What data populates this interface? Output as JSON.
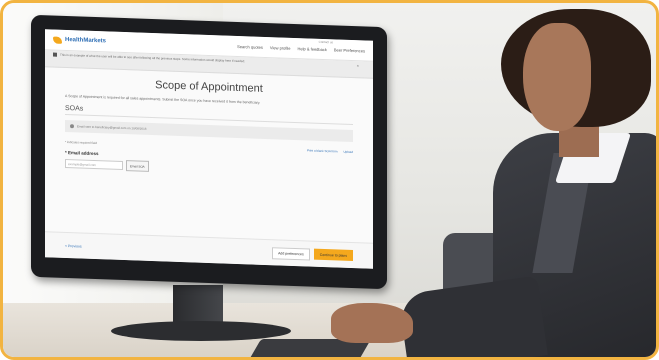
{
  "site": {
    "brand": "HealthMarkets",
    "nav": [
      "Search quotes",
      "View profile",
      "Help & feedback",
      "Beer Preferences"
    ],
    "header_note": "Contact us",
    "notice": "This is an example of what the user will be able to see after following all the previous steps. Some information would display here if needed."
  },
  "page": {
    "title": "Scope of Appointment",
    "intro": "A Scope of Appointment is required for all sales appointments. Submit the SOA once you have received it from the beneficiary.",
    "section_title": "SOAs",
    "info_text": "Email sent to beneficiary@gmail.com on 10/08/2018",
    "required_note": "* indicates required field",
    "actions": [
      "Print a blank SOA form",
      "Upload"
    ],
    "email_label": "* Email address",
    "email_value": "example@gmail.com",
    "email_button": "Email SOA"
  },
  "footer": {
    "back": "< Previous",
    "add": "Add preferences",
    "continue": "Continue to plans"
  },
  "colors": {
    "accent": "#f4a81d",
    "link": "#2f6fb5",
    "frame": "#f2b441"
  }
}
